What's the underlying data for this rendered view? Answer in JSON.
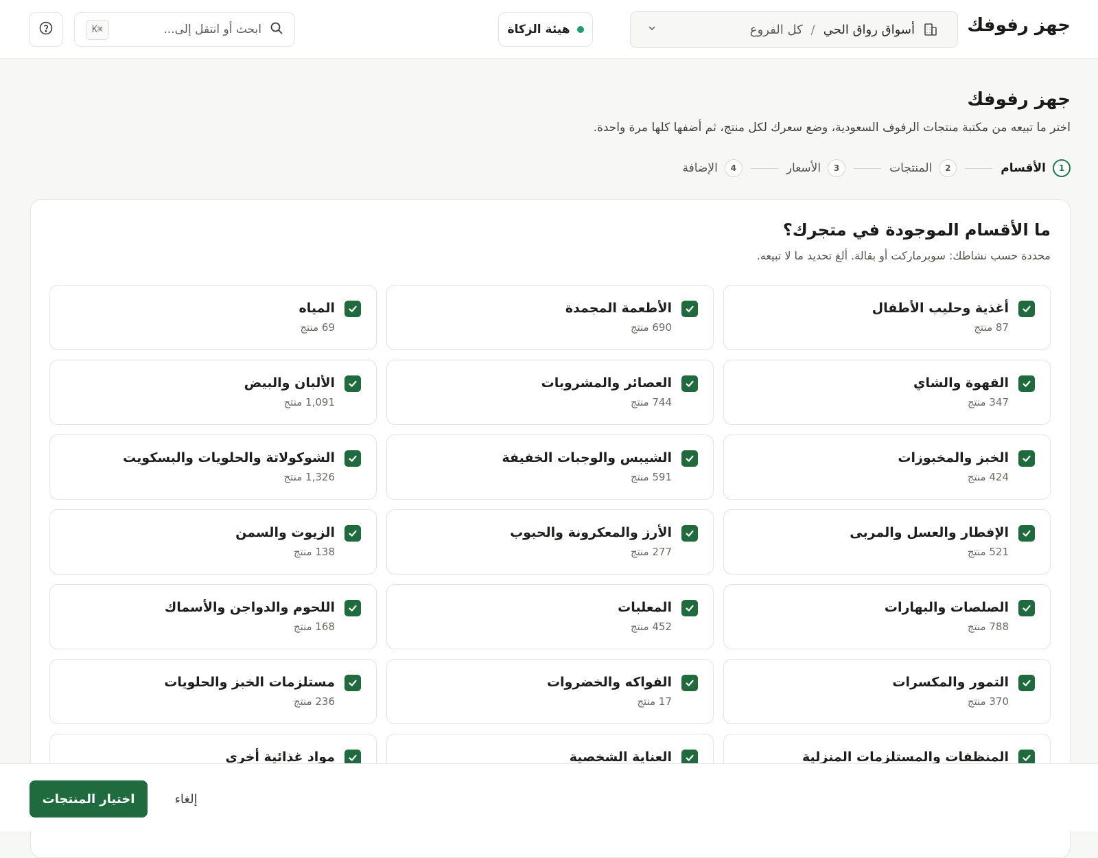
{
  "topbar": {
    "brand": "جهز رفوفك",
    "store_name": "أسواق رواق الحي",
    "branch_separator": "/",
    "branch_value": "كل الفروع",
    "zakat_label": "هيئة الزكاة",
    "search_placeholder": "ابحث أو انتقل إلى...",
    "search_shortcut": "⌘K",
    "icons": {
      "building": "building-icon",
      "chevron": "chevron-down-icon",
      "search": "search-icon",
      "help": "help-icon"
    },
    "status_color": "#1f9d6b"
  },
  "page": {
    "title": "جهز رفوفك",
    "subtitle": "اختر ما تبيعه من مكتبة منتجات الرفوف السعودية، وضع سعرك لكل منتج، ثم أضفها كلها مرة واحدة."
  },
  "steps": [
    {
      "num": "1",
      "label": "الأقسام",
      "active": true
    },
    {
      "num": "2",
      "label": "المنتجات",
      "active": false
    },
    {
      "num": "3",
      "label": "الأسعار",
      "active": false
    },
    {
      "num": "4",
      "label": "الإضافة",
      "active": false
    }
  ],
  "card": {
    "title": "ما الأقسام الموجودة في متجرك؟",
    "subtitle": "محددة حسب نشاطك: سوبرماركت أو بقالة. ألغ تحديد ما لا تبيعه."
  },
  "categories": [
    {
      "name": "أغذية وحليب الأطفال",
      "count": "87 منتج",
      "checked": true
    },
    {
      "name": "الأطعمة المجمدة",
      "count": "690 منتج",
      "checked": true
    },
    {
      "name": "المياه",
      "count": "69 منتج",
      "checked": true
    },
    {
      "name": "القهوة والشاي",
      "count": "347 منتج",
      "checked": true
    },
    {
      "name": "العصائر والمشروبات",
      "count": "744 منتج",
      "checked": true
    },
    {
      "name": "الألبان والبيض",
      "count": "1,091 منتج",
      "checked": true
    },
    {
      "name": "الخبز والمخبوزات",
      "count": "424 منتج",
      "checked": true
    },
    {
      "name": "الشيبس والوجبات الخفيفة",
      "count": "591 منتج",
      "checked": true
    },
    {
      "name": "الشوكولاتة والحلويات والبسكويت",
      "count": "1,326 منتج",
      "checked": true
    },
    {
      "name": "الإفطار والعسل والمربى",
      "count": "521 منتج",
      "checked": true
    },
    {
      "name": "الأرز والمعكرونة والحبوب",
      "count": "277 منتج",
      "checked": true
    },
    {
      "name": "الزيوت والسمن",
      "count": "138 منتج",
      "checked": true
    },
    {
      "name": "الصلصات والبهارات",
      "count": "788 منتج",
      "checked": true
    },
    {
      "name": "المعلبات",
      "count": "452 منتج",
      "checked": true
    },
    {
      "name": "اللحوم والدواجن والأسماك",
      "count": "168 منتج",
      "checked": true
    },
    {
      "name": "التمور والمكسرات",
      "count": "370 منتج",
      "checked": true
    },
    {
      "name": "الفواكه والخضروات",
      "count": "17 منتج",
      "checked": true
    },
    {
      "name": "مستلزمات الخبز والحلويات",
      "count": "236 منتج",
      "checked": true
    },
    {
      "name": "المنظفات والمستلزمات المنزلية",
      "count": "",
      "checked": true
    },
    {
      "name": "العناية الشخصية",
      "count": "",
      "checked": true
    },
    {
      "name": "مواد غذائية أخرى",
      "count": "",
      "checked": true
    }
  ],
  "footer": {
    "primary_label": "اختيار المنتجات",
    "cancel_label": "إلغاء"
  },
  "colors": {
    "accent": "#1f6b3e",
    "step_active": "#1f7a4a"
  }
}
